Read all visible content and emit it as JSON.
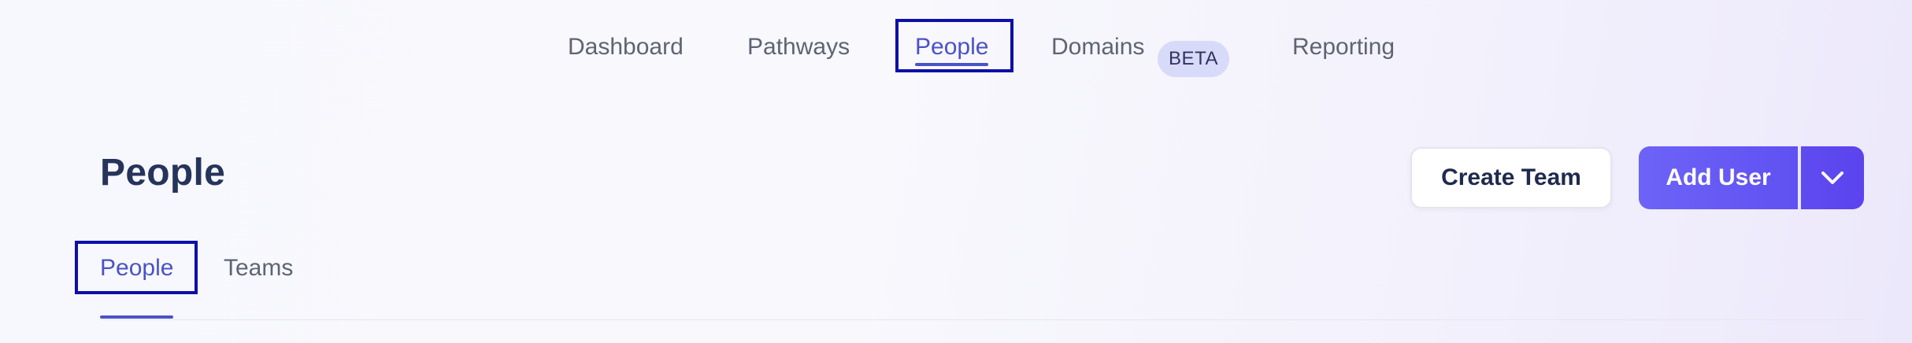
{
  "topnav": {
    "items": [
      {
        "label": "Dashboard"
      },
      {
        "label": "Pathways"
      },
      {
        "label": "People"
      },
      {
        "label": "Domains",
        "badge": "BETA"
      },
      {
        "label": "Reporting"
      }
    ],
    "active": "People"
  },
  "page": {
    "title": "People"
  },
  "actions": {
    "create_team_label": "Create Team",
    "add_user_label": "Add User",
    "dropdown_icon": "chevron-down-icon"
  },
  "subtabs": {
    "items": [
      {
        "label": "People"
      },
      {
        "label": "Teams"
      }
    ],
    "active": "People"
  },
  "colors": {
    "accent": "#4b52c8",
    "primary_button": "#6358f4",
    "title": "#26345c",
    "highlight_box": "#0d0fa8",
    "beta_badge_bg": "#d7daf8"
  }
}
